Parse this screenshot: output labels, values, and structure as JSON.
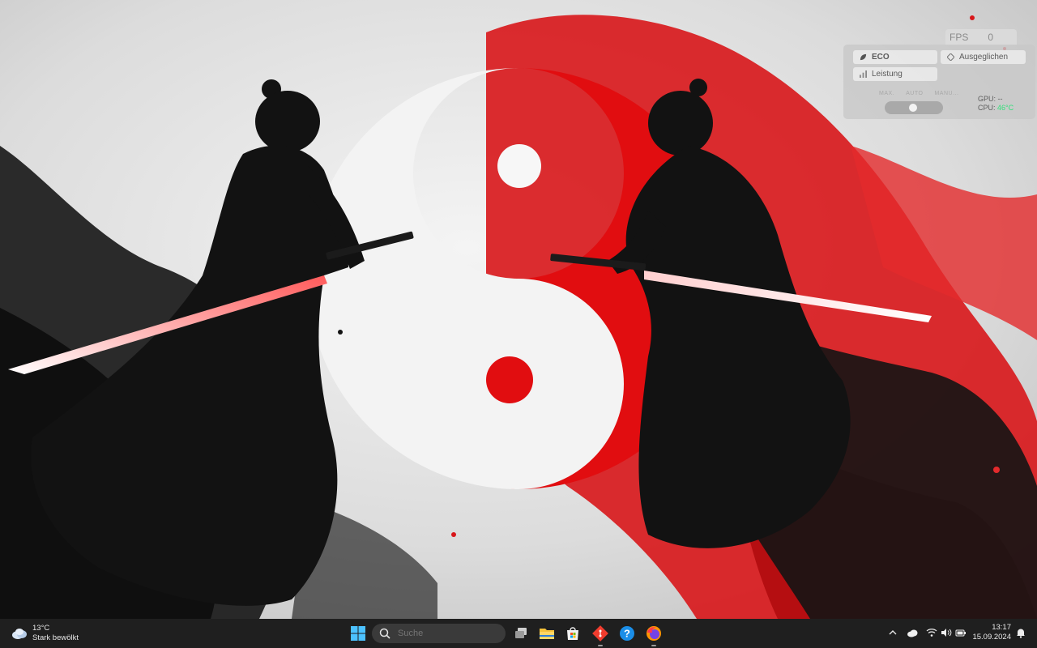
{
  "fps_widget": {
    "label": "FPS",
    "value": "0"
  },
  "power_modes": {
    "eco": "ECO",
    "balanced": "Ausgeglichen",
    "performance": "Leistung"
  },
  "fan": {
    "max": "MAX.",
    "auto": "AUTO",
    "manual": "MANU..."
  },
  "sensors": {
    "gpu_label": "GPU:",
    "gpu_value": "--",
    "cpu_label": "CPU:",
    "cpu_value": "46°C",
    "cpu_color": "#33e07a"
  },
  "weather": {
    "temp": "13°C",
    "condition": "Stark bewölkt"
  },
  "search": {
    "placeholder": "Suche"
  },
  "taskbar_apps": [
    "start-icon",
    "task-view-icon",
    "file-explorer-icon",
    "microsoft-store-icon",
    "git-app-icon",
    "help-icon",
    "firefox-icon"
  ],
  "tray_icons": [
    "chevron-up-icon",
    "onedrive-cloud-icon",
    "wifi-icon",
    "volume-icon",
    "battery-icon",
    "notification-bell-icon"
  ],
  "clock": {
    "time": "13:17",
    "date": "15.09.2024"
  },
  "colors": {
    "accent_red": "#e10d10",
    "taskbar": "#1f1f1f",
    "ink_black": "#121212"
  }
}
